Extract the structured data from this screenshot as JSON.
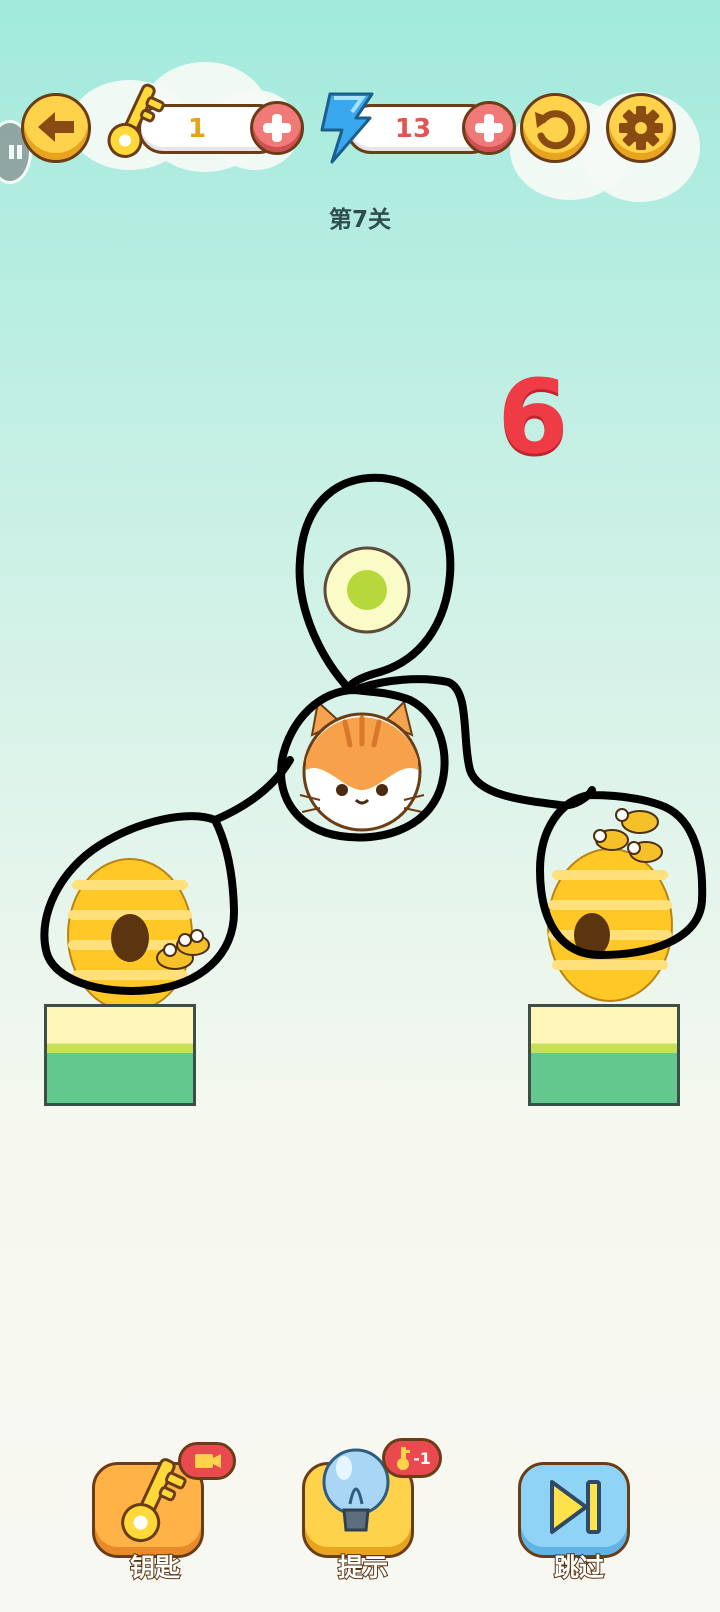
{
  "header": {
    "keys_count": "1",
    "energy_count": "13"
  },
  "level": {
    "title": "第7关",
    "countdown": "6"
  },
  "bottom": {
    "key_label": "钥匙",
    "hint_label": "提示",
    "hint_badge": "-1",
    "skip_label": "跳过"
  },
  "colors": {
    "accent_yellow": "#ffd24c",
    "outline_brown": "#6b3d16",
    "plus_red": "#f07a78",
    "skip_blue": "#8fd4f7",
    "countdown_red": "#ef3b45"
  },
  "icons": [
    "pause-icon",
    "back-arrow-icon",
    "key-icon",
    "plus-icon",
    "lightning-icon",
    "restart-icon",
    "gear-icon",
    "video-icon",
    "lightbulb-icon",
    "skip-icon"
  ]
}
